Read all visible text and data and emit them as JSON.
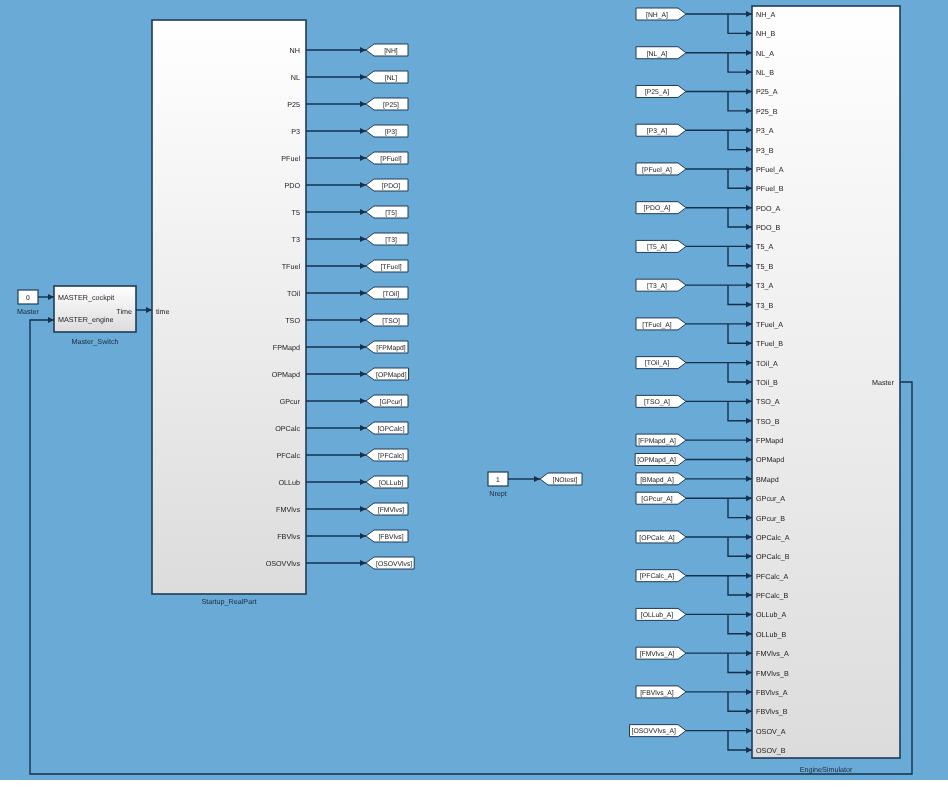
{
  "diagram": {
    "master_constant": {
      "value": "0",
      "label": "Master"
    },
    "master_switch": {
      "name": "Master_Switch",
      "inputs": [
        "MASTER_cockpit",
        "MASTER_engine"
      ],
      "output": "Time"
    },
    "startup_block": {
      "name": "Startup_RealPart",
      "input": "time",
      "outputs": [
        "NH",
        "NL",
        "P25",
        "P3",
        "PFuel",
        "PDO",
        "T5",
        "T3",
        "TFuel",
        "TOil",
        "TSO",
        "FPMapd",
        "OPMapd",
        "GPcur",
        "OPCalc",
        "PFCalc",
        "OLLub",
        "FMVlvs",
        "FBVlvs",
        "OSOVVlvs"
      ],
      "goto_tags": [
        "[NH]",
        "[NL]",
        "[P25]",
        "[P3]",
        "[PFuel]",
        "[PDO]",
        "[T5]",
        "[T3]",
        "[TFuel]",
        "[TOil]",
        "[TSO]",
        "[FPMapd]",
        "[OPMapd]",
        "[GPcur]",
        "[OPCalc]",
        "[PFCalc]",
        "[OLLub]",
        "[FMVlvs]",
        "[FBVlvs]",
        "[OSOVVlvs]"
      ]
    },
    "test_constant": {
      "value": "1",
      "label": "Nrept",
      "goto_tag": "[NOtest]"
    },
    "engine_block": {
      "name": "EngineSimulator",
      "output": "Master",
      "inputs": [
        {
          "tag": "[NH_A]",
          "ports": [
            "NH_A",
            "NH_B"
          ]
        },
        {
          "tag": "[NL_A]",
          "ports": [
            "NL_A",
            "NL_B"
          ]
        },
        {
          "tag": "[P25_A]",
          "ports": [
            "P25_A",
            "P25_B"
          ]
        },
        {
          "tag": "[P3_A]",
          "ports": [
            "P3_A",
            "P3_B"
          ]
        },
        {
          "tag": "[PFuel_A]",
          "ports": [
            "PFuel_A",
            "PFuel_B"
          ]
        },
        {
          "tag": "[PDO_A]",
          "ports": [
            "PDO_A",
            "PDO_B"
          ]
        },
        {
          "tag": "[T5_A]",
          "ports": [
            "T5_A",
            "T5_B"
          ]
        },
        {
          "tag": "[T3_A]",
          "ports": [
            "T3_A",
            "T3_B"
          ]
        },
        {
          "tag": "[TFuel_A]",
          "ports": [
            "TFuel_A",
            "TFuel_B"
          ]
        },
        {
          "tag": "[TOil_A]",
          "ports": [
            "TOil_A",
            "TOil_B"
          ]
        },
        {
          "tag": "[TSO_A]",
          "ports": [
            "TSO_A",
            "TSO_B"
          ]
        },
        {
          "tag": "[FPMapd_A]",
          "ports": [
            "FPMapd"
          ]
        },
        {
          "tag": "[OPMapd_A]",
          "ports": [
            "OPMapd"
          ]
        },
        {
          "tag": "[BMapd_A]",
          "ports": [
            "BMapd"
          ]
        },
        {
          "tag": "[GPcur_A]",
          "ports": [
            "GPcur_A",
            "GPcur_B"
          ]
        },
        {
          "tag": "[OPCalc_A]",
          "ports": [
            "OPCalc_A",
            "OPCalc_B"
          ]
        },
        {
          "tag": "[PFCalc_A]",
          "ports": [
            "PFCalc_A",
            "PFCalc_B"
          ]
        },
        {
          "tag": "[OLLub_A]",
          "ports": [
            "OLLub_A",
            "OLLub_B"
          ]
        },
        {
          "tag": "[FMVlvs_A]",
          "ports": [
            "FMVlvs_A",
            "FMVlvs_B"
          ]
        },
        {
          "tag": "[FBVlvs_A]",
          "ports": [
            "FBVlvs_A",
            "FBVlvs_B"
          ]
        },
        {
          "tag": "[OSOVVlvs_A]",
          "ports": [
            "OSOV_A",
            "OSOV_B"
          ]
        }
      ]
    }
  }
}
